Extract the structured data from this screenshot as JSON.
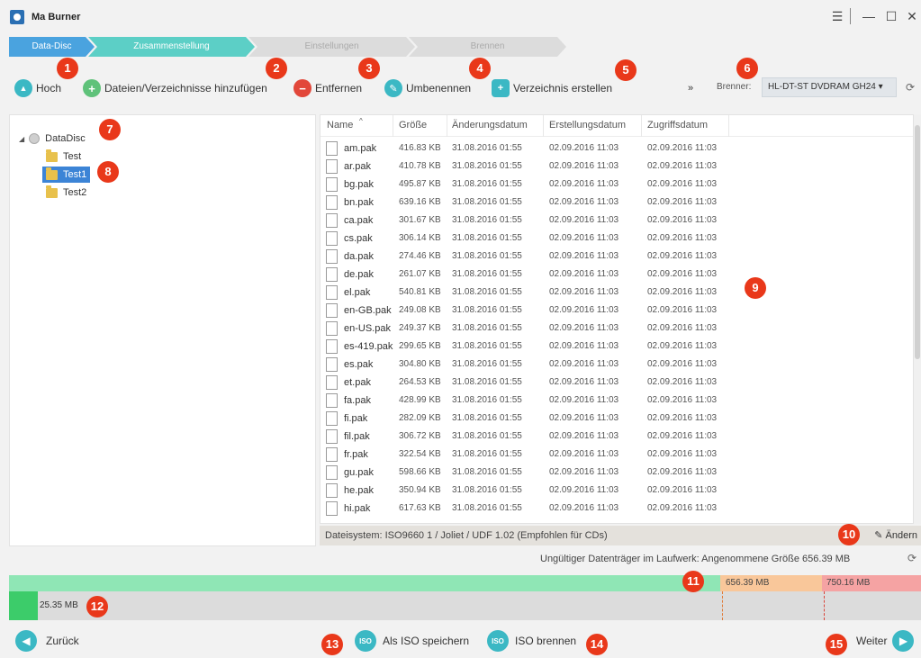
{
  "window": {
    "title": "Ma Burner"
  },
  "steps": [
    "Data-Disc",
    "Zusammenstellung",
    "Einstellungen",
    "Brennen"
  ],
  "toolbar": {
    "up": "Hoch",
    "add": "Dateien/Verzeichnisse hinzufügen",
    "remove": "Entfernen",
    "rename": "Umbenennen",
    "create_dir": "Verzeichnis erstellen",
    "more": "»",
    "burner_label": "Brenner:",
    "burner_value": "HL-DT-ST DVDRAM GH24 ▾"
  },
  "tree": {
    "root": "DataDisc",
    "folders": [
      "Test",
      "Test1",
      "Test2"
    ]
  },
  "columns": {
    "name": "Name",
    "size": "Größe",
    "modified": "Änderungsdatum",
    "created": "Erstellungsdatum",
    "accessed": "Zugriffsdatum"
  },
  "files": [
    {
      "name": "am.pak",
      "size": "416.83 KB",
      "modified": "31.08.2016 01:55",
      "created": "02.09.2016 11:03",
      "accessed": "02.09.2016 11:03"
    },
    {
      "name": "ar.pak",
      "size": "410.78 KB",
      "modified": "31.08.2016 01:55",
      "created": "02.09.2016 11:03",
      "accessed": "02.09.2016 11:03"
    },
    {
      "name": "bg.pak",
      "size": "495.87 KB",
      "modified": "31.08.2016 01:55",
      "created": "02.09.2016 11:03",
      "accessed": "02.09.2016 11:03"
    },
    {
      "name": "bn.pak",
      "size": "639.16 KB",
      "modified": "31.08.2016 01:55",
      "created": "02.09.2016 11:03",
      "accessed": "02.09.2016 11:03"
    },
    {
      "name": "ca.pak",
      "size": "301.67 KB",
      "modified": "31.08.2016 01:55",
      "created": "02.09.2016 11:03",
      "accessed": "02.09.2016 11:03"
    },
    {
      "name": "cs.pak",
      "size": "306.14 KB",
      "modified": "31.08.2016 01:55",
      "created": "02.09.2016 11:03",
      "accessed": "02.09.2016 11:03"
    },
    {
      "name": "da.pak",
      "size": "274.46 KB",
      "modified": "31.08.2016 01:55",
      "created": "02.09.2016 11:03",
      "accessed": "02.09.2016 11:03"
    },
    {
      "name": "de.pak",
      "size": "261.07 KB",
      "modified": "31.08.2016 01:55",
      "created": "02.09.2016 11:03",
      "accessed": "02.09.2016 11:03"
    },
    {
      "name": "el.pak",
      "size": "540.81 KB",
      "modified": "31.08.2016 01:55",
      "created": "02.09.2016 11:03",
      "accessed": "02.09.2016 11:03"
    },
    {
      "name": "en-GB.pak",
      "size": "249.08 KB",
      "modified": "31.08.2016 01:55",
      "created": "02.09.2016 11:03",
      "accessed": "02.09.2016 11:03"
    },
    {
      "name": "en-US.pak",
      "size": "249.37 KB",
      "modified": "31.08.2016 01:55",
      "created": "02.09.2016 11:03",
      "accessed": "02.09.2016 11:03"
    },
    {
      "name": "es-419.pak",
      "size": "299.65 KB",
      "modified": "31.08.2016 01:55",
      "created": "02.09.2016 11:03",
      "accessed": "02.09.2016 11:03"
    },
    {
      "name": "es.pak",
      "size": "304.80 KB",
      "modified": "31.08.2016 01:55",
      "created": "02.09.2016 11:03",
      "accessed": "02.09.2016 11:03"
    },
    {
      "name": "et.pak",
      "size": "264.53 KB",
      "modified": "31.08.2016 01:55",
      "created": "02.09.2016 11:03",
      "accessed": "02.09.2016 11:03"
    },
    {
      "name": "fa.pak",
      "size": "428.99 KB",
      "modified": "31.08.2016 01:55",
      "created": "02.09.2016 11:03",
      "accessed": "02.09.2016 11:03"
    },
    {
      "name": "fi.pak",
      "size": "282.09 KB",
      "modified": "31.08.2016 01:55",
      "created": "02.09.2016 11:03",
      "accessed": "02.09.2016 11:03"
    },
    {
      "name": "fil.pak",
      "size": "306.72 KB",
      "modified": "31.08.2016 01:55",
      "created": "02.09.2016 11:03",
      "accessed": "02.09.2016 11:03"
    },
    {
      "name": "fr.pak",
      "size": "322.54 KB",
      "modified": "31.08.2016 01:55",
      "created": "02.09.2016 11:03",
      "accessed": "02.09.2016 11:03"
    },
    {
      "name": "gu.pak",
      "size": "598.66 KB",
      "modified": "31.08.2016 01:55",
      "created": "02.09.2016 11:03",
      "accessed": "02.09.2016 11:03"
    },
    {
      "name": "he.pak",
      "size": "350.94 KB",
      "modified": "31.08.2016 01:55",
      "created": "02.09.2016 11:03",
      "accessed": "02.09.2016 11:03"
    },
    {
      "name": "hi.pak",
      "size": "617.63 KB",
      "modified": "31.08.2016 01:55",
      "created": "02.09.2016 11:03",
      "accessed": "02.09.2016 11:03"
    }
  ],
  "filesystem": {
    "text": "Dateisystem: ISO9660 1 / Joliet / UDF 1.02 (Empfohlen für CDs)",
    "change": "Ändern"
  },
  "status": {
    "text": "Ungültiger Datenträger im Laufwerk: Angenommene Größe 656.39 MB"
  },
  "capacity": {
    "used": "25.35 MB",
    "mark1": "656.39 MB",
    "mark2": "750.16 MB",
    "max_mb": 810
  },
  "bottom": {
    "back": "Zurück",
    "save_iso": "Als ISO speichern",
    "burn_iso": "ISO brennen",
    "next": "Weiter"
  },
  "badges": [
    "1",
    "2",
    "3",
    "4",
    "5",
    "6",
    "7",
    "8",
    "9",
    "10",
    "11",
    "12",
    "13",
    "14",
    "15"
  ],
  "colors": {
    "step_done": "#4aa3df",
    "step_active": "#5ccfc6",
    "step_inactive": "#d9d9d9",
    "accent": "#3bb8c4",
    "badge": "#e9381a",
    "cap_green": "#8fe6b5",
    "cap_orange": "#f9c79a",
    "cap_red": "#f5a3a3",
    "used_green": "#3ccc6a"
  }
}
